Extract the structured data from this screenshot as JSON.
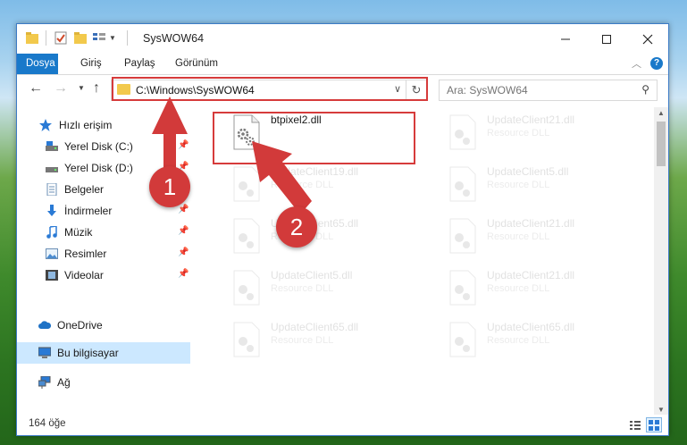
{
  "window": {
    "title": "SysWOW64"
  },
  "ribbon": {
    "tabs": [
      "Dosya",
      "Giriş",
      "Paylaş",
      "Görünüm"
    ],
    "help": "?"
  },
  "address": {
    "path": "C:\\Windows\\SysWOW64"
  },
  "search": {
    "placeholder": "Ara: SysWOW64"
  },
  "sidebar": {
    "items": [
      {
        "label": "Hızlı erişim",
        "icon": "star-icon"
      },
      {
        "label": "Yerel Disk (C:)",
        "icon": "drive-icon"
      },
      {
        "label": "Yerel Disk (D:)",
        "icon": "drive-icon"
      },
      {
        "label": "Belgeler",
        "icon": "documents-icon"
      },
      {
        "label": "İndirmeler",
        "icon": "download-icon"
      },
      {
        "label": "Müzik",
        "icon": "music-icon"
      },
      {
        "label": "Resimler",
        "icon": "pictures-icon"
      },
      {
        "label": "Videolar",
        "icon": "video-icon"
      },
      {
        "label": "OneDrive",
        "icon": "cloud-icon"
      },
      {
        "label": "Bu bilgisayar",
        "icon": "computer-icon"
      },
      {
        "label": "Ağ",
        "icon": "network-icon"
      }
    ]
  },
  "files": [
    {
      "name": "btpixel2.dll",
      "type": ""
    },
    {
      "name": "UpdateClient21.dll",
      "type": "Resource DLL"
    },
    {
      "name": "UpdateClient19.dll",
      "type": "Resource DLL"
    },
    {
      "name": "UpdateClient5.dll",
      "type": "Resource DLL"
    },
    {
      "name": "UpdateClient65.dll",
      "type": "Resource DLL"
    },
    {
      "name": "UpdateClient21.dll",
      "type": "Resource DLL"
    },
    {
      "name": "UpdateClient5.dll",
      "type": "Resource DLL"
    },
    {
      "name": "UpdateClient21.dll",
      "type": "Resource DLL"
    },
    {
      "name": "UpdateClient65.dll",
      "type": "Resource DLL"
    },
    {
      "name": "UpdateClient65.dll",
      "type": "Resource DLL"
    }
  ],
  "status": {
    "count": "164 öğe"
  },
  "annotations": {
    "badge1": "1",
    "badge2": "2",
    "color": "#d23a3a"
  }
}
